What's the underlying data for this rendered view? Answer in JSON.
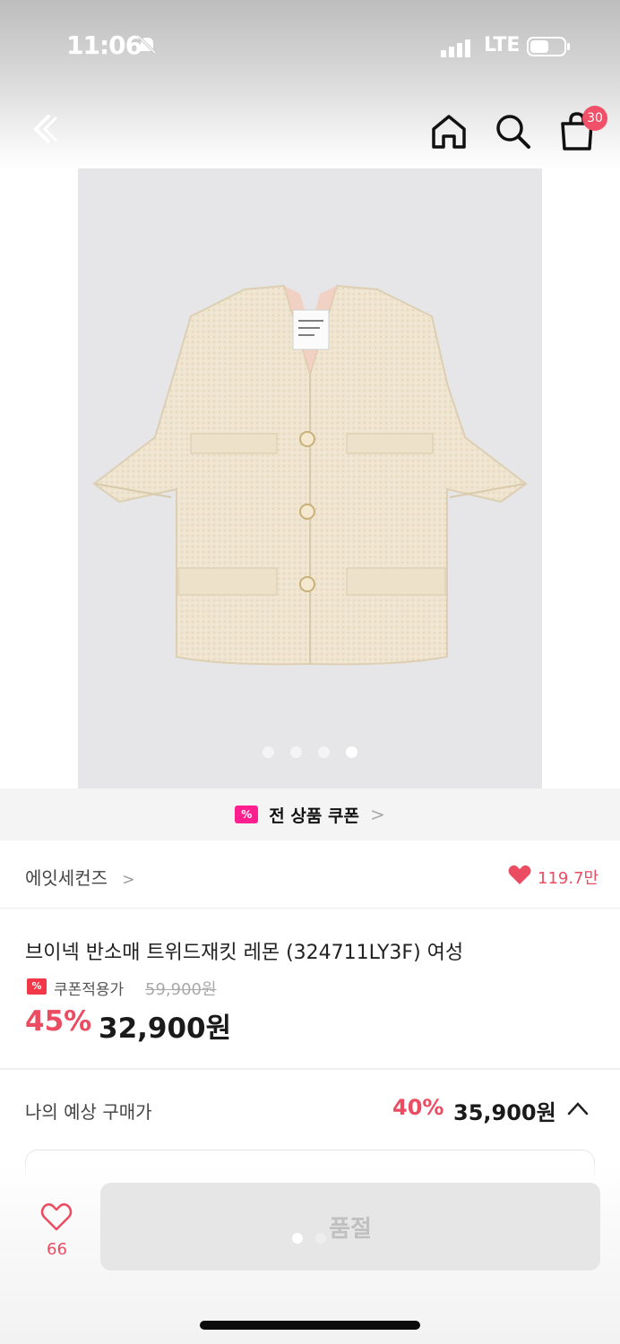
{
  "status_bar": {
    "time": "11:06",
    "network": "LTE"
  },
  "nav": {
    "cart_count": "30"
  },
  "product_image": {
    "slide_count": 4,
    "active_slide": 4
  },
  "coupon_banner": {
    "text": "전 상품 쿠폰",
    "chevron": ">"
  },
  "brand": {
    "name": "에잇세컨즈",
    "chevron": ">",
    "likes": "119.7만"
  },
  "product": {
    "title": "브이넥 반소매 트위드재킷 레몬 (324711LY3F) 여성",
    "coupon_price_label": "쿠폰적용가",
    "original_price": "59,900원",
    "discount_rate": "45%",
    "sale_price": "32,900원"
  },
  "expected_price": {
    "label": "나의 예상 구매가",
    "rate": "40%",
    "price": "35,900원"
  },
  "bottom_bar": {
    "wish_count": "66",
    "button_label": "품절"
  },
  "colors": {
    "accent": "#ec4c62",
    "coupon_pink": "#ff1f8e",
    "jacket": "#efe4cf"
  }
}
